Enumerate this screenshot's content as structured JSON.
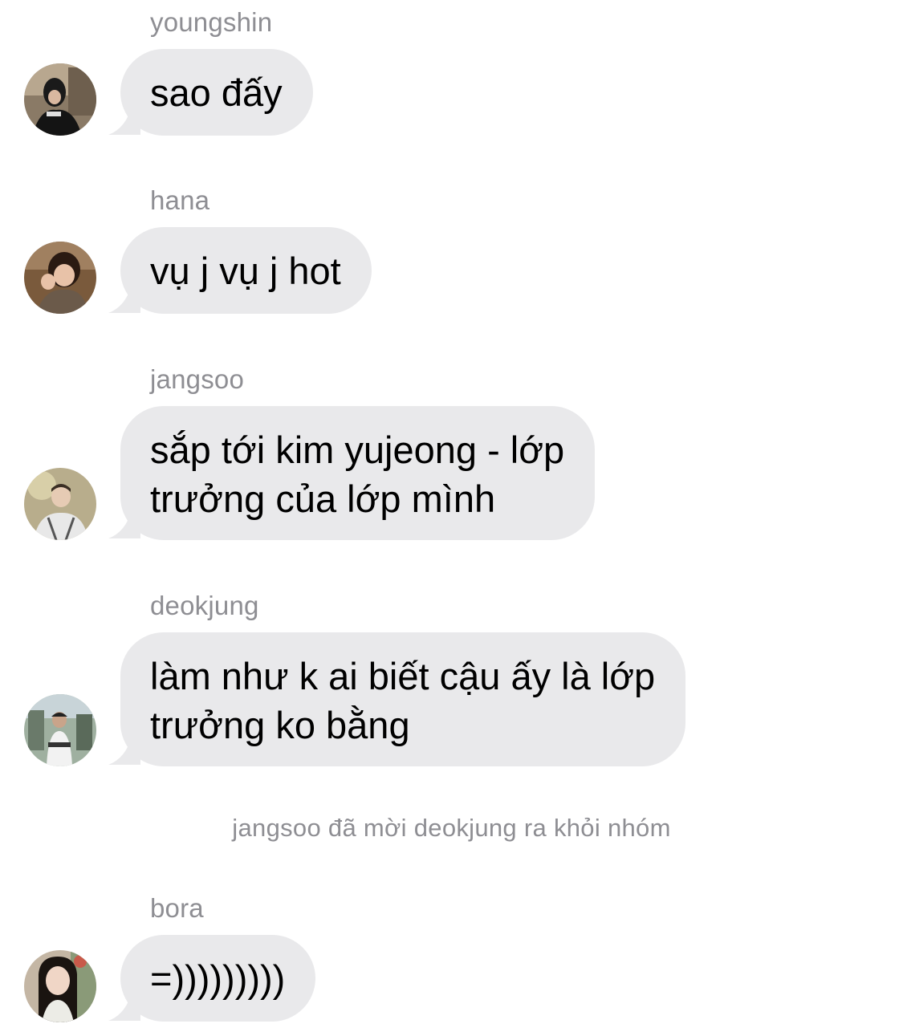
{
  "messages": [
    {
      "sender": "youngshin",
      "lines": [
        "sao đấy"
      ]
    },
    {
      "sender": "hana",
      "lines": [
        "vụ j vụ j hot"
      ]
    },
    {
      "sender": "jangsoo",
      "lines": [
        "sắp tới kim yujeong - lớp",
        "trưởng của lớp mình"
      ]
    },
    {
      "sender": "deokjung",
      "lines": [
        "làm như k ai biết cậu ấy là lớp",
        "trưởng ko bằng"
      ]
    },
    {
      "sender": "bora",
      "lines": [
        "=)))))))))"
      ]
    }
  ],
  "system_notice": "jangsoo đã mời deokjung ra khỏi nhóm",
  "colors": {
    "bubble_background": "#e9e9eb",
    "sender_name": "#8e8e93",
    "system_text": "#8e8e93",
    "message_text": "#000000"
  },
  "icons": [
    "avatar-youngshin",
    "avatar-hana",
    "avatar-jangsoo",
    "avatar-deokjung",
    "avatar-bora"
  ]
}
